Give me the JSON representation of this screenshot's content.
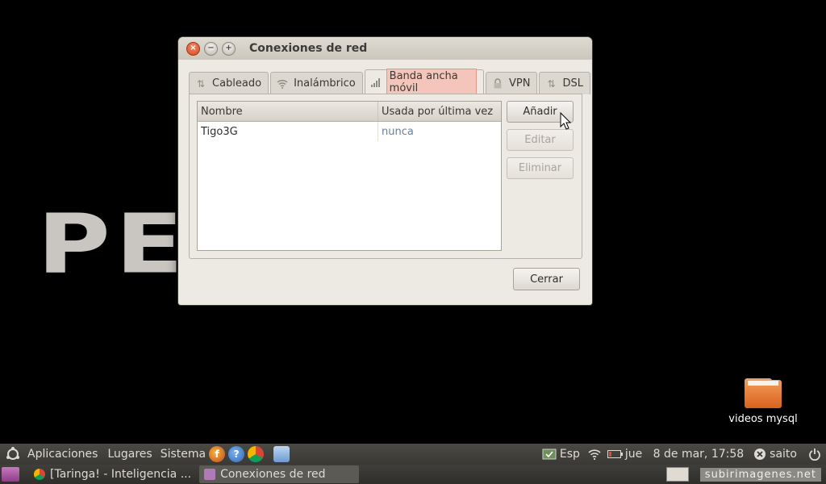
{
  "window": {
    "title": "Conexiones de red",
    "controls": {
      "close": "×",
      "minimize": "−",
      "maximize": "+"
    }
  },
  "tabs": [
    {
      "label": "Cableado",
      "icon": "wired-icon"
    },
    {
      "label": "Inalámbrico",
      "icon": "wifi-icon"
    },
    {
      "label": "Banda ancha móvil",
      "icon": "signal-icon",
      "active": true
    },
    {
      "label": "VPN",
      "icon": "lock-icon"
    },
    {
      "label": "DSL",
      "icon": "dsl-icon"
    }
  ],
  "list": {
    "columns": [
      "Nombre",
      "Usada por última vez"
    ],
    "rows": [
      {
        "name": "Tigo3G",
        "last_used": "nunca"
      }
    ]
  },
  "buttons": {
    "add": "Añadir",
    "edit": "Editar",
    "delete": "Eliminar",
    "close": "Cerrar"
  },
  "desktop": {
    "wallpaper_text": "PE AM",
    "folder_label": "videos mysql"
  },
  "top_panel": {
    "menus": [
      "Aplicaciones",
      "Lugares",
      "Sistema"
    ],
    "launchers": [
      "firefox-icon",
      "help-icon",
      "chrome-icon",
      "package-icon"
    ],
    "keyboard": "Esp",
    "date": "jue   8 de mar, 17:58",
    "user": "saito"
  },
  "bottom_panel": {
    "tasks": [
      {
        "label": "[Taringa! - Inteligencia ...",
        "icon": "chrome-icon"
      },
      {
        "label": "Conexiones de red",
        "icon": "network-icon",
        "active": true
      }
    ],
    "watermark": "subirimagenes.net"
  },
  "colors": {
    "dialog_bg": "#ede9e3",
    "active_tab_highlight": "#f4c6bb",
    "close_button": "#d9471e",
    "panel_bg": "#3a3935"
  }
}
